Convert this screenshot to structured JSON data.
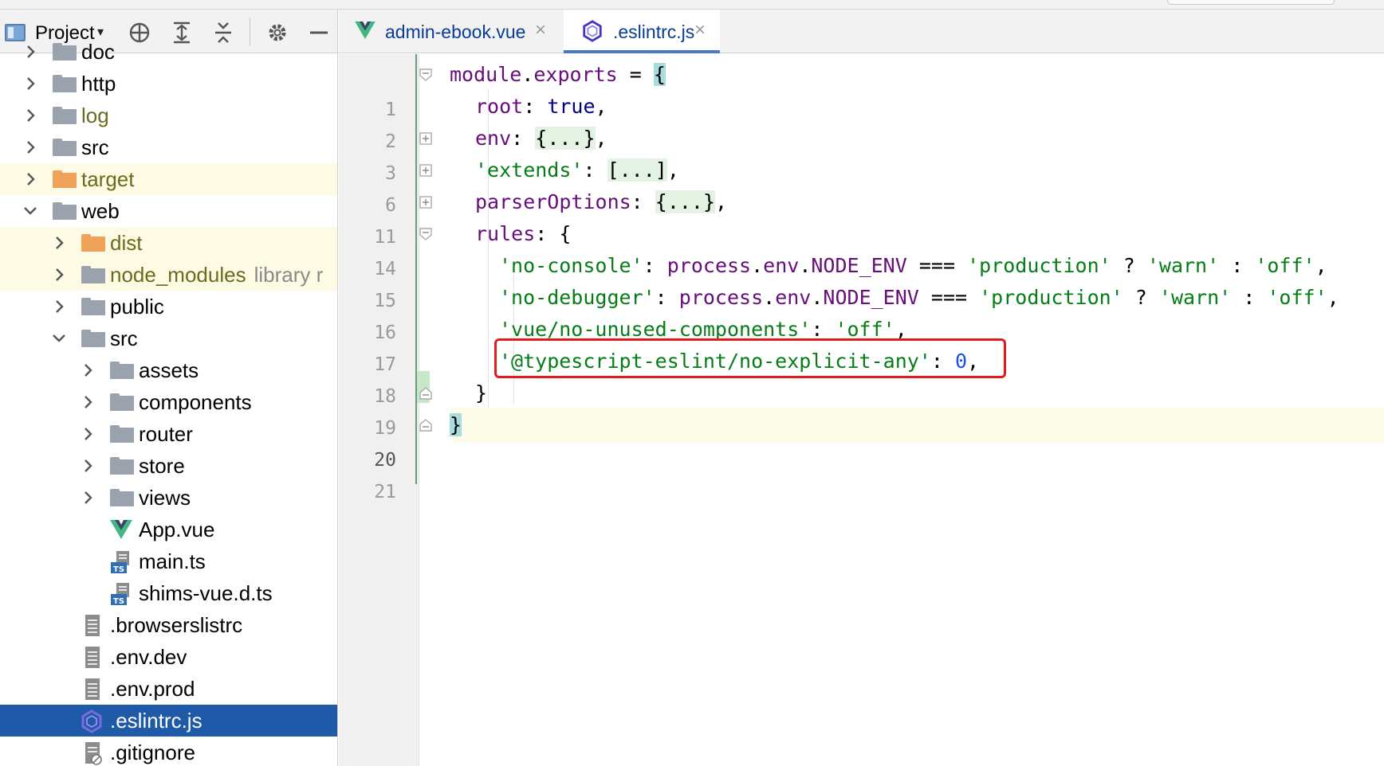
{
  "project_panel": {
    "title": "Project",
    "tree": [
      {
        "label": "doc"
      },
      {
        "label": "http"
      },
      {
        "label": "log"
      },
      {
        "label": "src"
      },
      {
        "label": "target"
      },
      {
        "label": "web"
      },
      {
        "label": "dist"
      },
      {
        "label": "node_modules",
        "extra": "library r"
      },
      {
        "label": "public"
      },
      {
        "label": "src"
      },
      {
        "label": "assets"
      },
      {
        "label": "components"
      },
      {
        "label": "router"
      },
      {
        "label": "store"
      },
      {
        "label": "views"
      },
      {
        "label": "App.vue"
      },
      {
        "label": "main.ts"
      },
      {
        "label": "shims-vue.d.ts"
      },
      {
        "label": ".browserslistrc"
      },
      {
        "label": ".env.dev"
      },
      {
        "label": ".env.prod"
      },
      {
        "label": ".eslintrc.js"
      },
      {
        "label": ".gitignore"
      }
    ]
  },
  "editor": {
    "tabs": [
      {
        "label": "admin-ebook.vue",
        "icon": "vue-icon"
      },
      {
        "label": ".eslintrc.js",
        "icon": "eslint-icon",
        "active": true
      }
    ],
    "line_numbers": [
      "1",
      "2",
      "3",
      "6",
      "11",
      "14",
      "15",
      "16",
      "17",
      "18",
      "19",
      "20",
      "21"
    ],
    "code": {
      "l1_a": "module",
      "l1_b": ".",
      "l1_c": "exports",
      "l1_d": " = ",
      "l1_e": "{",
      "l2_a": "root",
      "l2_b": ": ",
      "l2_c": "true",
      "l2_d": ",",
      "l3_a": "env",
      "l3_b": ": ",
      "l3_c": "{...}",
      "l3_d": ",",
      "l6_a": "'extends'",
      "l6_b": ": ",
      "l6_c": "[...]",
      "l6_d": ",",
      "l11_a": "parserOptions",
      "l11_b": ": ",
      "l11_c": "{...}",
      "l11_d": ",",
      "l14_a": "rules",
      "l14_b": ": {",
      "l15_a": "'no-console'",
      "l15_b": ": ",
      "l15_c": "process",
      "l15_d": ".",
      "l15_e": "env",
      "l15_f": ".",
      "l15_g": "NODE_ENV",
      "l15_h": " === ",
      "l15_i": "'production'",
      "l15_j": " ? ",
      "l15_k": "'warn'",
      "l15_l": " : ",
      "l15_m": "'off'",
      "l15_n": ",",
      "l16_a": "'no-debugger'",
      "l16_b": ": ",
      "l16_c": "process",
      "l16_d": ".",
      "l16_e": "env",
      "l16_f": ".",
      "l16_g": "NODE_ENV",
      "l16_h": " === ",
      "l16_i": "'production'",
      "l16_j": " ? ",
      "l16_k": "'warn'",
      "l16_l": " : ",
      "l16_m": "'off'",
      "l16_n": ",",
      "l17_a": "'vue/no-unused-components'",
      "l17_b": ": ",
      "l17_c": "'off'",
      "l17_d": ",",
      "l18_a": "'@typescript-eslint/no-explicit-any'",
      "l18_b": ": ",
      "l18_c": "0",
      "l18_d": ",",
      "l19_a": "}",
      "l20_a": "}"
    }
  },
  "colors": {
    "selection": "#1e5aa8",
    "excluded_bg": "#fdfbe3",
    "highlight_border": "#e21b1b",
    "string": "#067d17",
    "property": "#660e7a",
    "keyword": "#000080",
    "number": "#1750eb"
  }
}
